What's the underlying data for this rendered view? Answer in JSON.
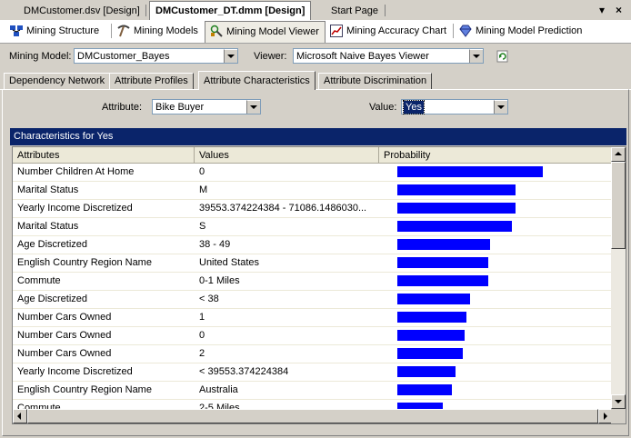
{
  "doc_tabs": [
    "DMCustomer.dsv [Design]",
    "DMCustomer_DT.dmm [Design]",
    "Start Page"
  ],
  "doc_controls": {
    "menu": "▾",
    "close": "×"
  },
  "designer_tabs": [
    "Mining Structure",
    "Mining Models",
    "Mining Model Viewer",
    "Mining Accuracy Chart",
    "Mining Model Prediction"
  ],
  "model_row": {
    "mining_model_label": "Mining Model:",
    "mining_model_value": "DMCustomer_Bayes",
    "viewer_label": "Viewer:",
    "viewer_value": "Microsoft Naive Bayes Viewer"
  },
  "viewer_tabs": [
    "Dependency Network",
    "Attribute Profiles",
    "Attribute Characteristics",
    "Attribute Discrimination"
  ],
  "selectors": {
    "attribute_label": "Attribute:",
    "attribute_value": "Bike Buyer",
    "value_label": "Value:",
    "value_value": "Yes"
  },
  "header_title": "Characteristics for Yes",
  "columns": [
    "Attributes",
    "Values",
    "Probability"
  ],
  "rows": [
    {
      "attribute": "Number Children At Home",
      "value": "0",
      "probability": 0.8
    },
    {
      "attribute": "Marital Status",
      "value": "M",
      "probability": 0.65
    },
    {
      "attribute": "Yearly Income Discretized",
      "value": "39553.374224384 - 71086.1486030...",
      "probability": 0.65
    },
    {
      "attribute": "Marital Status",
      "value": "S",
      "probability": 0.63
    },
    {
      "attribute": "Age Discretized",
      "value": "38 - 49",
      "probability": 0.51
    },
    {
      "attribute": "English Country Region Name",
      "value": "United States",
      "probability": 0.5
    },
    {
      "attribute": "Commute",
      "value": "0-1 Miles",
      "probability": 0.5
    },
    {
      "attribute": "Age Discretized",
      "value": "< 38",
      "probability": 0.4
    },
    {
      "attribute": "Number Cars Owned",
      "value": "1",
      "probability": 0.38
    },
    {
      "attribute": "Number Cars Owned",
      "value": "0",
      "probability": 0.37
    },
    {
      "attribute": "Number Cars Owned",
      "value": "2",
      "probability": 0.36
    },
    {
      "attribute": "Yearly Income Discretized",
      "value": "< 39553.374224384",
      "probability": 0.32
    },
    {
      "attribute": "English Country Region Name",
      "value": "Australia",
      "probability": 0.3
    },
    {
      "attribute": "Commute",
      "value": "2-5 Miles",
      "probability": 0.25
    }
  ],
  "colors": {
    "bar": "#0000ff",
    "header": "#0a246a",
    "selection": "#0a246a"
  }
}
